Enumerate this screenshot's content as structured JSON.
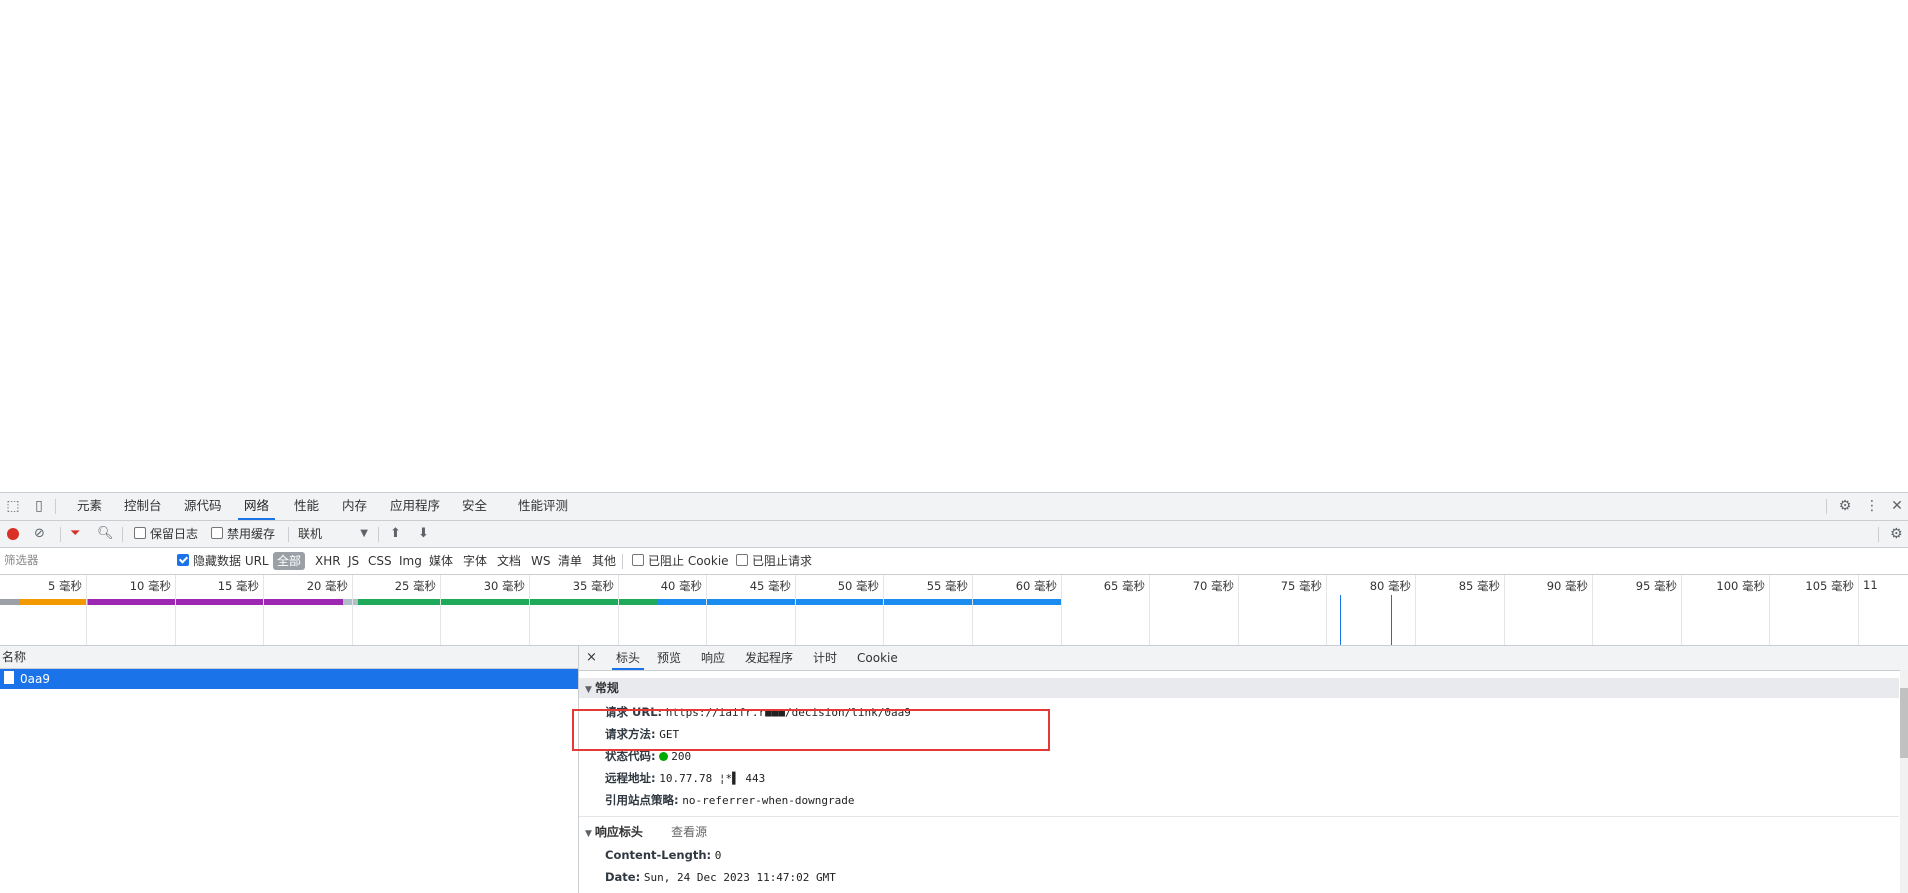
{
  "main_tabs": [
    "元素",
    "控制台",
    "源代码",
    "网络",
    "性能",
    "内存",
    "应用程序",
    "安全",
    "性能评测"
  ],
  "active_tab_index": 3,
  "toolbar": {
    "preserve_log": "保留日志",
    "disable_cache": "禁用缓存",
    "throttling": "联机"
  },
  "filter": {
    "placeholder": "筛选器",
    "hide_data_urls": "隐藏数据 URL",
    "types": [
      "全部",
      "XHR",
      "JS",
      "CSS",
      "Img",
      "媒体",
      "字体",
      "文档",
      "WS",
      "清单",
      "其他"
    ],
    "blocked_cookies": "已阻止 Cookie",
    "blocked_requests": "已阻止请求"
  },
  "timeline": {
    "ticks": [
      "5 毫秒",
      "10 毫秒",
      "15 毫秒",
      "20 毫秒",
      "25 毫秒",
      "30 毫秒",
      "35 毫秒",
      "40 毫秒",
      "45 毫秒",
      "50 毫秒",
      "55 毫秒",
      "60 毫秒",
      "65 毫秒",
      "70 毫秒",
      "75 毫秒",
      "80 毫秒",
      "85 毫秒",
      "90 毫秒",
      "95 毫秒",
      "100 毫秒",
      "105 毫秒",
      "11"
    ]
  },
  "request_list": {
    "header": "名称",
    "items": [
      "0aa9"
    ]
  },
  "details": {
    "close": "×",
    "tabs": [
      "标头",
      "预览",
      "响应",
      "发起程序",
      "计时",
      "Cookie"
    ],
    "general": {
      "title": "常规",
      "rows": [
        {
          "k": "请求 URL:",
          "v": "https://iaifr.r■■■/decision/link/0aa9"
        },
        {
          "k": "请求方法:",
          "v": "GET"
        },
        {
          "k": "状态代码:",
          "v": "200"
        },
        {
          "k": "远程地址:",
          "v": "10.77.78 ¦*▌ 443"
        },
        {
          "k": "引用站点策略:",
          "v": "no-referrer-when-downgrade"
        }
      ]
    },
    "response_headers": {
      "title": "响应标头",
      "view_source": "查看源",
      "rows": [
        {
          "k": "Content-Length:",
          "v": "0"
        },
        {
          "k": "Date:",
          "v": "Sun, 24 Dec 2023 11:47:02 GMT"
        }
      ]
    }
  }
}
